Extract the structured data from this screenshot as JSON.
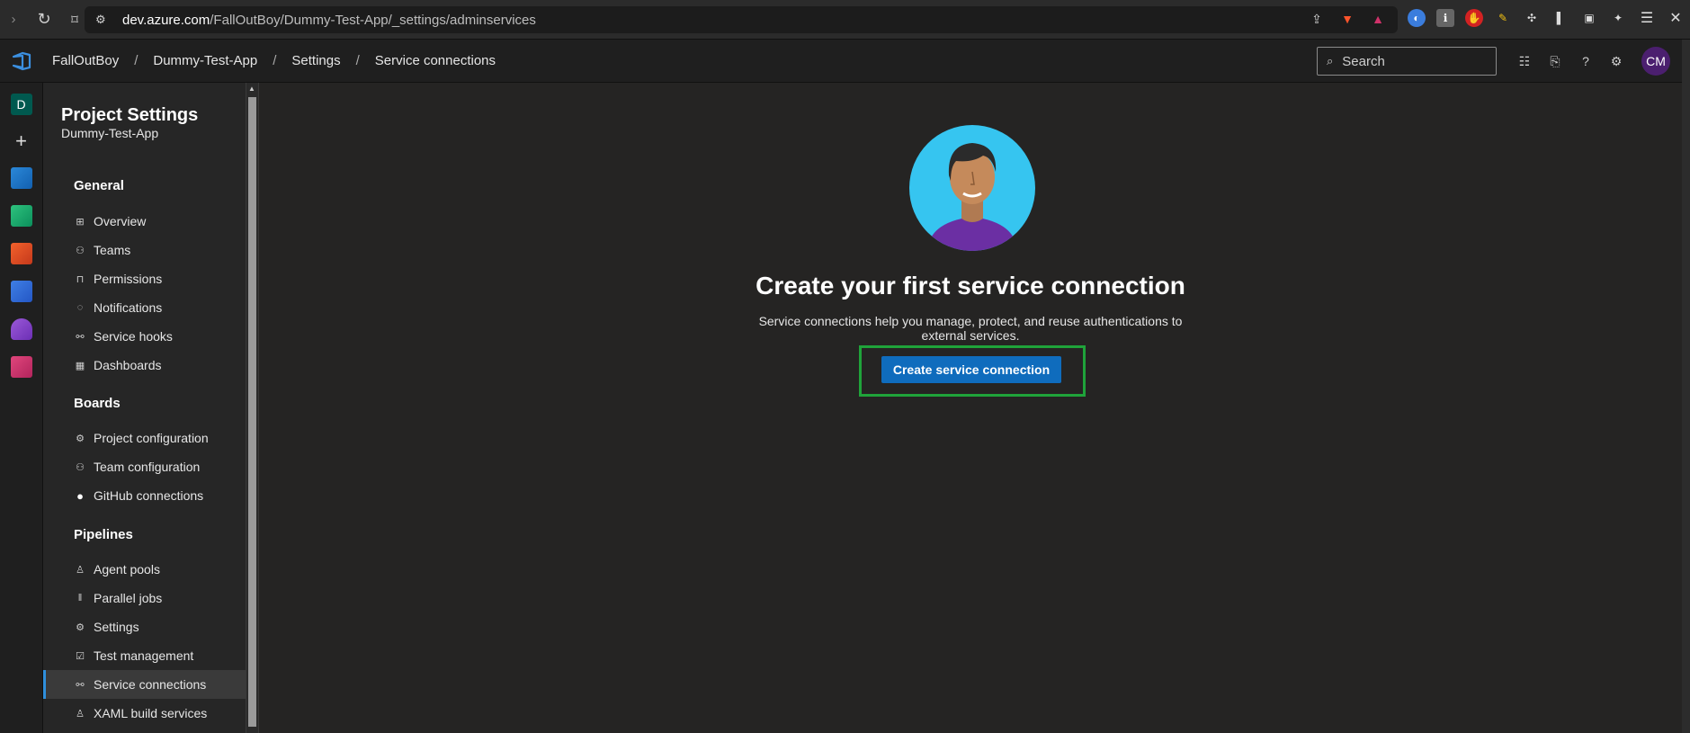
{
  "browser": {
    "url_host": "dev.azure.com",
    "url_path": "/FallOutBoy/Dummy-Test-App/_settings/adminservices"
  },
  "header": {
    "breadcrumbs": [
      "FallOutBoy",
      "Dummy-Test-App",
      "Settings",
      "Service connections"
    ],
    "breadcrumb_separator": "/",
    "search_placeholder": "Search",
    "avatar_initials": "CM"
  },
  "rail": {
    "project_initial": "D",
    "add_symbol": "+"
  },
  "sidebar": {
    "title": "Project Settings",
    "subtitle": "Dummy-Test-App",
    "sections": [
      {
        "label": "General",
        "items": [
          {
            "label": "Overview",
            "icon": "overview-icon"
          },
          {
            "label": "Teams",
            "icon": "teams-icon"
          },
          {
            "label": "Permissions",
            "icon": "lock-icon"
          },
          {
            "label": "Notifications",
            "icon": "notification-icon"
          },
          {
            "label": "Service hooks",
            "icon": "plug-icon"
          },
          {
            "label": "Dashboards",
            "icon": "dashboard-icon"
          }
        ]
      },
      {
        "label": "Boards",
        "items": [
          {
            "label": "Project configuration",
            "icon": "doc-gear-icon"
          },
          {
            "label": "Team configuration",
            "icon": "team-gear-icon"
          },
          {
            "label": "GitHub connections",
            "icon": "github-icon"
          }
        ]
      },
      {
        "label": "Pipelines",
        "items": [
          {
            "label": "Agent pools",
            "icon": "agent-icon"
          },
          {
            "label": "Parallel jobs",
            "icon": "parallel-icon"
          },
          {
            "label": "Settings",
            "icon": "gear-icon"
          },
          {
            "label": "Test management",
            "icon": "test-icon"
          },
          {
            "label": "Service connections",
            "icon": "plug-icon",
            "active": true
          },
          {
            "label": "XAML build services",
            "icon": "agent-icon"
          }
        ]
      }
    ]
  },
  "main": {
    "title": "Create your first service connection",
    "description": "Service connections help you manage, protect, and reuse authentications to external services.",
    "create_button_label": "Create service connection",
    "highlight_color": "#1fa33a",
    "button_color": "#0f6cbd"
  }
}
